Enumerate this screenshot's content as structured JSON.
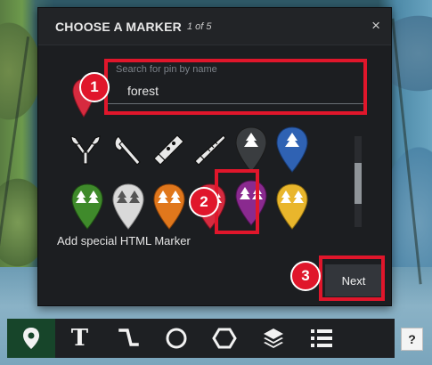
{
  "dialog": {
    "title": "CHOOSE A MARKER",
    "step": "1 of 5",
    "close_symbol": "×",
    "search": {
      "placeholder": "Search for pin by name",
      "value": "forest"
    },
    "html_marker_label": "Add special HTML Marker",
    "next_label": "Next",
    "preview_pin_color": "#d62b3f",
    "markers": [
      {
        "icon": "axes-icon",
        "type": "tool"
      },
      {
        "icon": "axe-icon",
        "type": "tool"
      },
      {
        "icon": "saw-icon",
        "type": "tool"
      },
      {
        "icon": "handsaw-icon",
        "type": "tool"
      },
      {
        "icon": "forest-pin-gray-dark",
        "color": "#3a3d40",
        "type": "pin"
      },
      {
        "icon": "forest-pin-blue",
        "color": "#2f62b3",
        "type": "pin"
      },
      {
        "icon": "forest-pin-green",
        "color": "#3f8a2b",
        "type": "pin"
      },
      {
        "icon": "forest-pin-white",
        "color": "#d9d9d9",
        "type": "pin"
      },
      {
        "icon": "forest-pin-orange",
        "color": "#e0771c",
        "type": "pin"
      },
      {
        "icon": "forest-pin-red",
        "color": "#d62b3f",
        "type": "pin"
      },
      {
        "icon": "forest-pin-purple",
        "color": "#8a2a8f",
        "type": "pin",
        "selected": true
      },
      {
        "icon": "forest-pin-yellow",
        "color": "#e9b62c",
        "type": "pin"
      }
    ]
  },
  "callouts": [
    "1",
    "2",
    "3"
  ],
  "toolbar": {
    "items": [
      {
        "icon": "map-pin-icon",
        "active": true
      },
      {
        "icon": "text-tool-icon",
        "label": "T"
      },
      {
        "icon": "polyline-icon"
      },
      {
        "icon": "circle-icon"
      },
      {
        "icon": "hexagon-icon"
      },
      {
        "icon": "layers-icon"
      },
      {
        "icon": "list-icon"
      }
    ],
    "help_label": "?"
  },
  "colors": {
    "accent_red": "#e0162b",
    "active_tool": "#17452a",
    "dialog_bg": "#1c1e21"
  }
}
